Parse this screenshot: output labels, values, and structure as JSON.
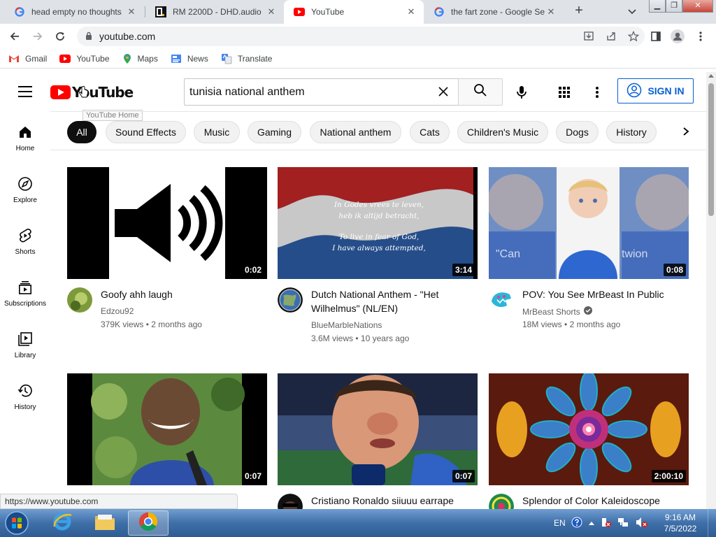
{
  "browser": {
    "tabs": [
      {
        "title": "head empty no thoughts",
        "favicon": "google-g-icon",
        "active": false
      },
      {
        "title": "RM 2200D - DHD.audio",
        "favicon": "dhd-icon",
        "active": false
      },
      {
        "title": "YouTube",
        "favicon": "youtube-icon",
        "active": true
      },
      {
        "title": "the fart zone - Google Se",
        "favicon": "google-g-icon",
        "active": false
      }
    ],
    "tab_close_glyph": "✕",
    "new_tab_glyph": "+",
    "url": "youtube.com",
    "bookmarks": [
      {
        "label": "Gmail",
        "icon": "gmail-icon"
      },
      {
        "label": "YouTube",
        "icon": "youtube-icon"
      },
      {
        "label": "Maps",
        "icon": "maps-icon"
      },
      {
        "label": "News",
        "icon": "news-icon"
      },
      {
        "label": "Translate",
        "icon": "translate-icon"
      }
    ],
    "status_url": "https://www.youtube.com"
  },
  "youtube": {
    "logo_text": "YouTube",
    "logo_tooltip": "YouTube Home",
    "search_value": "tunisia national anthem",
    "signin_label": "SIGN IN",
    "chips": [
      "All",
      "Sound Effects",
      "Music",
      "Gaming",
      "National anthem",
      "Cats",
      "Children's Music",
      "Dogs",
      "History"
    ],
    "guide": [
      {
        "label": "Home",
        "icon": "home-icon"
      },
      {
        "label": "Explore",
        "icon": "compass-icon"
      },
      {
        "label": "Shorts",
        "icon": "shorts-icon"
      },
      {
        "label": "Subscriptions",
        "icon": "subscriptions-icon"
      },
      {
        "label": "Library",
        "icon": "library-icon"
      },
      {
        "label": "History",
        "icon": "history-icon"
      }
    ],
    "videos": [
      {
        "title": "Goofy ahh laugh",
        "channel": "Edzou92",
        "verified": false,
        "views": "379K views",
        "age": "2 months ago",
        "duration": "0:02"
      },
      {
        "title": "Dutch National Anthem - \"Het Wilhelmus\" (NL/EN)",
        "channel": "BlueMarbleNations",
        "verified": false,
        "views": "3.6M views",
        "age": "10 years ago",
        "duration": "3:14",
        "thumb_text": [
          "In Godes vrees te leven,",
          "heb ik altijd betracht,",
          "To live in fear of God,",
          "I have always attempted,"
        ]
      },
      {
        "title": "POV: You See MrBeast In Public",
        "channel": "MrBeast Shorts",
        "verified": true,
        "views": "18M views",
        "age": "2 months ago",
        "duration": "0:08",
        "thumb_text": [
          "\"Can",
          "twion"
        ]
      },
      {
        "title": "",
        "channel": "",
        "verified": false,
        "views": "",
        "age": "",
        "duration": "0:07"
      },
      {
        "title": "Cristiano Ronaldo siiuuu earrape",
        "channel": "",
        "verified": false,
        "views": "",
        "age": "",
        "duration": "0:07"
      },
      {
        "title": "Splendor of Color Kaleidoscope",
        "channel": "",
        "verified": false,
        "views": "",
        "age": "",
        "duration": "2:00:10"
      }
    ],
    "meta_separator": "•"
  },
  "taskbar": {
    "lang": "EN",
    "time": "9:16 AM",
    "date": "7/5/2022"
  },
  "colors": {
    "youtube_red": "#ff0000",
    "signin_blue": "#065fd4",
    "chip_selected": "#0f0f0f",
    "taskbar_blue": "#3f6fa8"
  }
}
